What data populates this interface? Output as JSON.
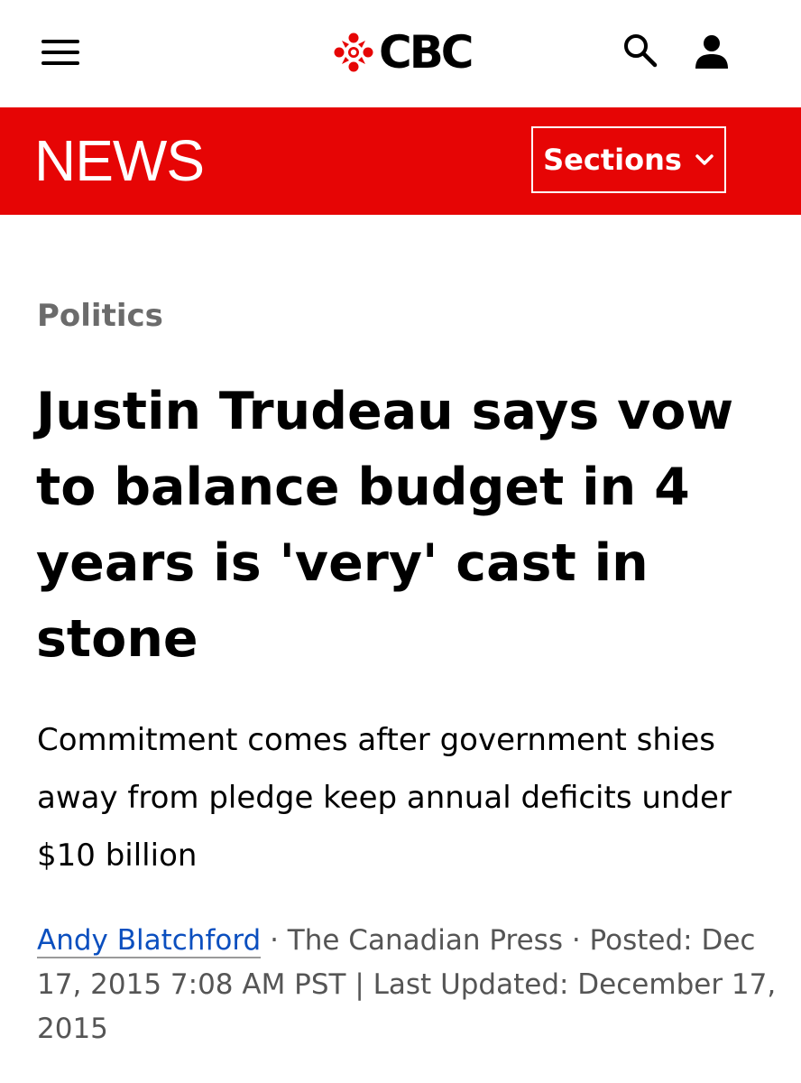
{
  "header": {
    "logo_text": "CBC",
    "icons": {
      "menu": "hamburger-menu-icon",
      "search": "search-icon",
      "account": "account-icon",
      "logo": "cbc-gem-logo"
    }
  },
  "newsbar": {
    "title": "NEWS",
    "sections_label": "Sections",
    "color": "#e60505"
  },
  "article": {
    "category": "Politics",
    "headline": "Justin Trudeau says vow to balance budget in 4 years is 'very' cast in stone",
    "subhead": "Commitment comes after government shies away from pledge keep annual deficits under $10 billion",
    "author": "Andy Blatchford",
    "separator": "·",
    "source": "The Canadian Press",
    "posted": "Posted: Dec 17, 2015 7:08 AM PST | Last Updated: December 17, 2015"
  },
  "colors": {
    "brand_red": "#e60505",
    "link_blue": "#0b4fbf",
    "muted_gray": "#6b6b6b"
  }
}
